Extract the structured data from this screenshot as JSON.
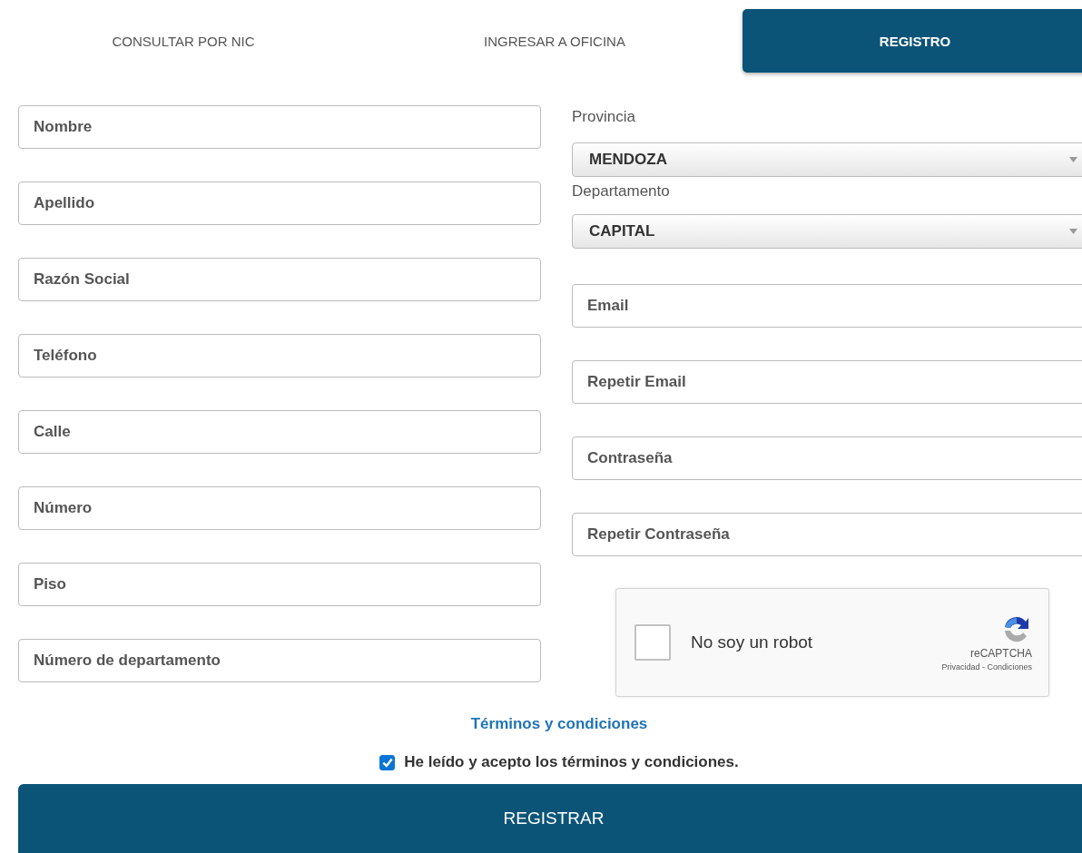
{
  "tabs": [
    {
      "label": "CONSULTAR POR NIC",
      "selected": false
    },
    {
      "label": "INGRESAR A OFICINA",
      "selected": false
    },
    {
      "label": "REGISTRO",
      "selected": true
    }
  ],
  "left_fields": [
    {
      "placeholder": "Nombre"
    },
    {
      "placeholder": "Apellido"
    },
    {
      "placeholder": "Razón Social"
    },
    {
      "placeholder": "Teléfono"
    },
    {
      "placeholder": "Calle"
    },
    {
      "placeholder": "Número"
    },
    {
      "placeholder": "Piso"
    },
    {
      "placeholder": "Número de departamento"
    }
  ],
  "selects": [
    {
      "label": "Provincia",
      "value": "MENDOZA"
    },
    {
      "label": "Departamento",
      "value": "CAPITAL"
    }
  ],
  "right_fields": [
    {
      "placeholder": "Email"
    },
    {
      "placeholder": "Repetir Email"
    },
    {
      "placeholder": "Contraseña"
    },
    {
      "placeholder": "Repetir Contraseña"
    }
  ],
  "captcha": {
    "label": "No soy un robot",
    "checked": false,
    "brand": "reCAPTCHA",
    "links": "Privacidad - Condiciones"
  },
  "terms_link": "Términos y condiciones",
  "accept": {
    "label": "He leído y acepto los términos y condiciones.",
    "checked": true
  },
  "submit": "REGISTRAR"
}
